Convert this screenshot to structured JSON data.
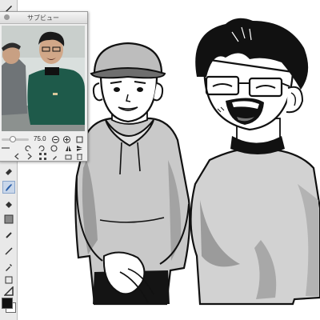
{
  "subview": {
    "title": "サブビュー",
    "zoom_value": "75.0",
    "zoom_level_fraction": 0.4
  },
  "toolbar": {
    "tools": [
      {
        "icon": "pen-icon"
      },
      {
        "icon": "pencil-icon"
      },
      {
        "icon": "marker-icon"
      },
      {
        "icon": "eraser-icon"
      },
      {
        "icon": "brush-icon"
      },
      {
        "icon": "fill-bucket-icon"
      },
      {
        "icon": "gradient-icon"
      },
      {
        "icon": "figure-icon"
      },
      {
        "icon": "line-icon"
      },
      {
        "icon": "eyedropper-icon"
      },
      {
        "icon": "blend-icon"
      },
      {
        "icon": "ruler-icon"
      }
    ],
    "active_tool": "brush-icon",
    "main_color": "#111111",
    "sub_color": "#ffffff"
  }
}
